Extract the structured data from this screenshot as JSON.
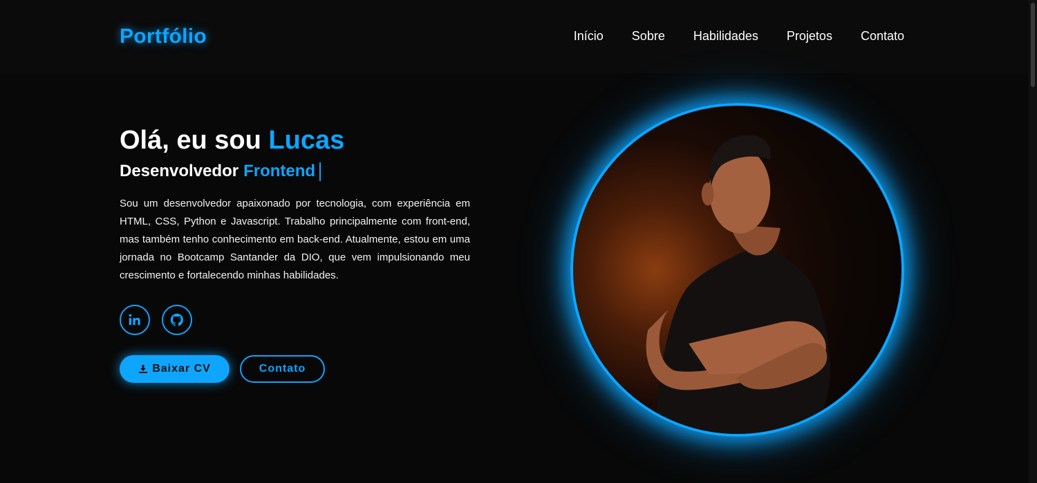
{
  "header": {
    "logo": "Portfólio",
    "nav": [
      "Início",
      "Sobre",
      "Habilidades",
      "Projetos",
      "Contato"
    ]
  },
  "hero": {
    "greeting": "Olá, eu sou",
    "name": "Lucas",
    "role_prefix": "Desenvolvedor",
    "role_accent": "Frontend",
    "description": "Sou um desenvolvedor apaixonado por tecnologia, com experiência em HTML, CSS, Python e Javascript. Trabalho principalmente com front-end, mas também tenho conhecimento em back-end. Atualmente, estou em uma jornada no Bootcamp Santander da DIO, que vem impulsionando meu crescimento e fortalecendo minhas habilidades.",
    "socials": [
      {
        "icon": "linkedin-icon"
      },
      {
        "icon": "github-icon"
      }
    ],
    "primary_button": "Baixar CV",
    "primary_button_icon": "download-icon",
    "secondary_button": "Contato"
  },
  "colors": {
    "accent": "#0ea5ff",
    "background": "#080808",
    "text": "#ffffff"
  }
}
